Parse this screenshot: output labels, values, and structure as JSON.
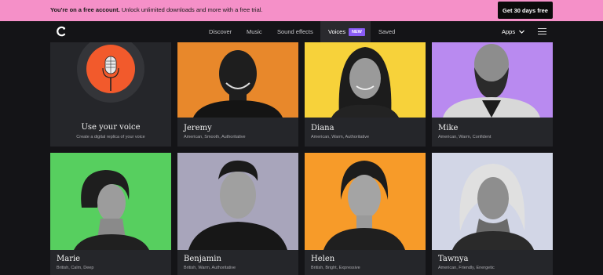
{
  "banner": {
    "bold_text": "You're on a free account.",
    "text": " Unlock unlimited downloads and more with a free trial.",
    "cta_label": "Get 30 days free",
    "bg_color": "#f590c8"
  },
  "nav": {
    "links": [
      {
        "label": "Discover"
      },
      {
        "label": "Music"
      },
      {
        "label": "Sound effects"
      },
      {
        "label": "Voices",
        "active": true,
        "badge": "NEW"
      },
      {
        "label": "Saved"
      }
    ],
    "apps_label": "Apps",
    "badge_color": "#8a5cf6"
  },
  "use_voice": {
    "title": "Use your voice",
    "subtitle": "Create a digital replica of your voice"
  },
  "voices": [
    {
      "name": "Jeremy",
      "tags": "American, Smooth, Authoritative",
      "bg": "#e8882b"
    },
    {
      "name": "Diana",
      "tags": "American, Warm, Authoritative",
      "bg": "#f7d23a"
    },
    {
      "name": "Mike",
      "tags": "American, Warm, Confident",
      "bg": "#b98af0"
    },
    {
      "name": "Marie",
      "tags": "British, Calm, Deep",
      "bg": "#57cf5f"
    },
    {
      "name": "Benjamin",
      "tags": "British, Warm, Authoritative",
      "bg": "#a8a5bb"
    },
    {
      "name": "Helen",
      "tags": "British, Bright, Expressive",
      "bg": "#f79b29"
    },
    {
      "name": "Tawnya",
      "tags": "American, Friendly, Energetic",
      "bg": "#d2d6e6"
    }
  ]
}
